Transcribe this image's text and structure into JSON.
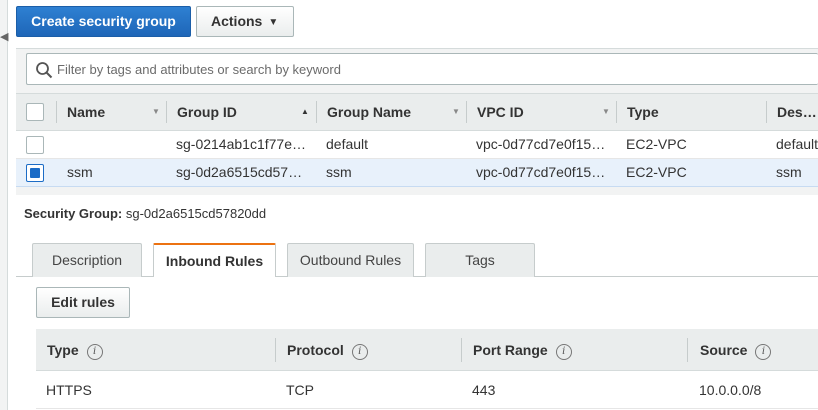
{
  "toolbar": {
    "create_label": "Create security group",
    "actions_label": "Actions"
  },
  "search": {
    "placeholder": "Filter by tags and attributes or search by keyword"
  },
  "table": {
    "columns": [
      "Name",
      "Group ID",
      "Group Name",
      "VPC ID",
      "Type",
      "Descri"
    ],
    "rows": [
      {
        "name": "",
        "group_id": "sg-0214ab1c1f77e…",
        "group_name": "default",
        "vpc_id": "vpc-0d77cd7e0f15…",
        "type": "EC2-VPC",
        "description": "default",
        "selected": false
      },
      {
        "name": "ssm",
        "group_id": "sg-0d2a6515cd57…",
        "group_name": "ssm",
        "vpc_id": "vpc-0d77cd7e0f15…",
        "type": "EC2-VPC",
        "description": "ssm",
        "selected": true
      }
    ]
  },
  "detail": {
    "label": "Security Group:",
    "value": "sg-0d2a6515cd57820dd",
    "tabs": [
      "Description",
      "Inbound Rules",
      "Outbound Rules",
      "Tags"
    ],
    "active_tab": "Inbound Rules",
    "edit_label": "Edit rules"
  },
  "rules": {
    "columns": [
      "Type",
      "Protocol",
      "Port Range",
      "Source"
    ],
    "rows": [
      {
        "type": "HTTPS",
        "protocol": "TCP",
        "port_range": "443",
        "source": "10.0.0.0/8"
      }
    ]
  },
  "colors": {
    "primary": "#1e66b8",
    "tab_accent": "#ec7211",
    "selected_row": "#e8f1fb"
  }
}
